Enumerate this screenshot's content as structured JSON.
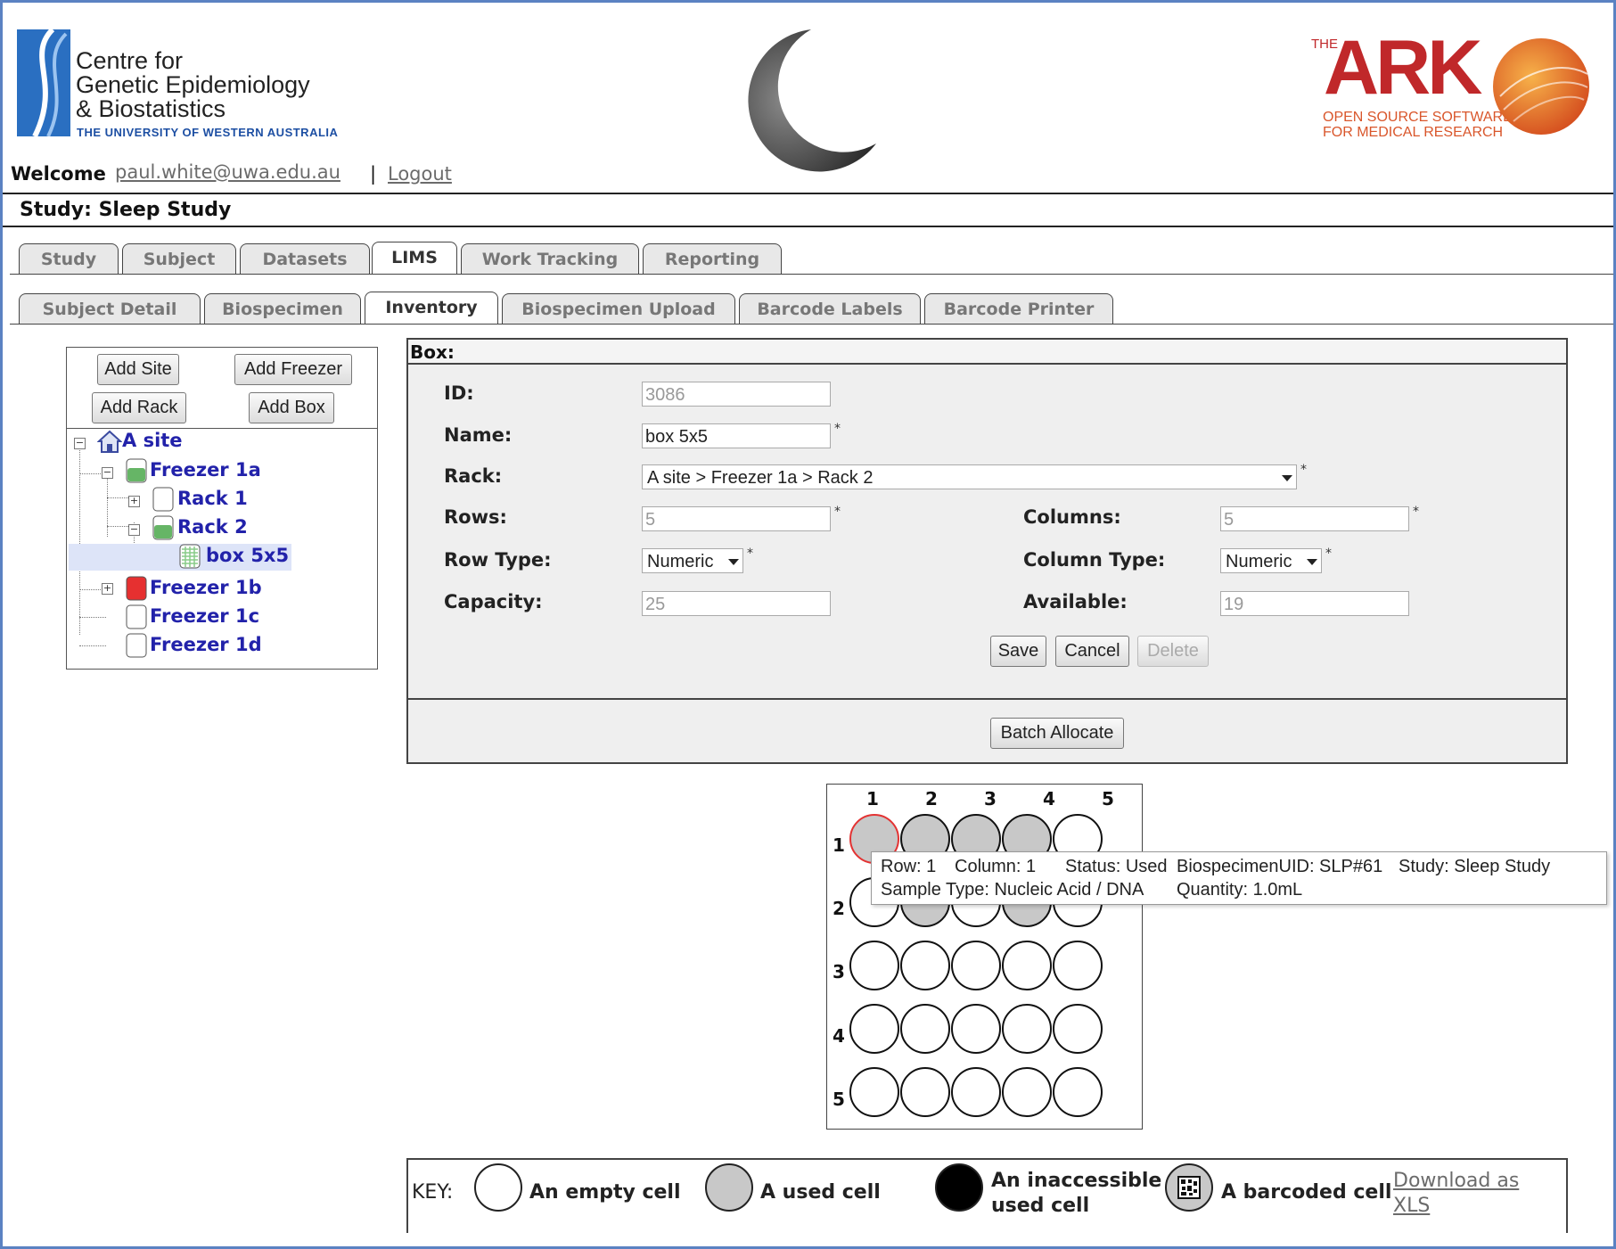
{
  "header": {
    "org_lines": [
      "Centre for",
      "Genetic Epidemiology",
      "& Biostatistics"
    ],
    "university": "THE UNIVERSITY OF WESTERN AUSTRALIA",
    "ark_the": "THE",
    "ark_title": "ARK",
    "ark_sub_lines": [
      "OPEN SOURCE SOFTWARE",
      "FOR MEDICAL RESEARCH"
    ],
    "welcome_label": "Welcome",
    "user_email": "paul.white@uwa.edu.au",
    "separator": "|",
    "logout_label": "Logout",
    "study_title": "Study: Sleep Study"
  },
  "main_tabs": [
    {
      "label": "Study",
      "active": false
    },
    {
      "label": "Subject",
      "active": false
    },
    {
      "label": "Datasets",
      "active": false
    },
    {
      "label": "LIMS",
      "active": true
    },
    {
      "label": "Work Tracking",
      "active": false
    },
    {
      "label": "Reporting",
      "active": false
    }
  ],
  "sub_tabs": [
    {
      "label": "Subject Detail",
      "active": false
    },
    {
      "label": "Biospecimen",
      "active": false
    },
    {
      "label": "Inventory",
      "active": true
    },
    {
      "label": "Biospecimen Upload",
      "active": false
    },
    {
      "label": "Barcode Labels",
      "active": false
    },
    {
      "label": "Barcode Printer",
      "active": false
    }
  ],
  "tree_buttons": {
    "add_site": "Add Site",
    "add_freezer": "Add Freezer",
    "add_rack": "Add Rack",
    "add_box": "Add Box"
  },
  "tree": [
    {
      "label": "A site",
      "icon": "house-icon"
    },
    {
      "label": "Freezer 1a",
      "icon": "freezer-icon"
    },
    {
      "label": "Rack 1",
      "icon": "rack-icon"
    },
    {
      "label": "Rack 2",
      "icon": "rack-icon"
    },
    {
      "label": "box 5x5",
      "icon": "box-icon"
    },
    {
      "label": "Freezer 1b",
      "icon": "freezer-icon"
    },
    {
      "label": "Freezer 1c",
      "icon": "freezer-icon"
    },
    {
      "label": "Freezer 1d",
      "icon": "freezer-icon"
    }
  ],
  "box_form": {
    "title": "Box:",
    "id_label": "ID:",
    "id_value": "3086",
    "name_label": "Name:",
    "name_value": "box 5x5",
    "rack_label": "Rack:",
    "rack_value": "A site > Freezer 1a   > Rack 2",
    "rows_label": "Rows:",
    "rows_value": "5",
    "columns_label": "Columns:",
    "columns_value": "5",
    "row_type_label": "Row Type:",
    "row_type_value": "Numeric",
    "column_type_label": "Column Type:",
    "column_type_value": "Numeric",
    "capacity_label": "Capacity:",
    "capacity_value": "25",
    "available_label": "Available:",
    "available_value": "19",
    "required_mark": "*",
    "save_label": "Save",
    "cancel_label": "Cancel",
    "delete_label": "Delete",
    "batch_allocate_label": "Batch Allocate"
  },
  "grid": {
    "columns": [
      "1",
      "2",
      "3",
      "4",
      "5"
    ],
    "rows": [
      "1",
      "2",
      "3",
      "4",
      "5"
    ],
    "cells": [
      [
        "used",
        "used",
        "used",
        "used",
        "empty"
      ],
      [
        "empty",
        "used",
        "empty",
        "used",
        "empty"
      ],
      [
        "empty",
        "empty",
        "empty",
        "empty",
        "empty"
      ],
      [
        "empty",
        "empty",
        "empty",
        "empty",
        "empty"
      ],
      [
        "empty",
        "empty",
        "empty",
        "empty",
        "empty"
      ]
    ],
    "highlight_color": "#e33333"
  },
  "tooltip": {
    "row": "Row: 1",
    "column": "Column: 1",
    "status": "Status: Used",
    "uid": "BiospecimenUID: SLP#61",
    "study": "Study: Sleep Study",
    "sample_type": "Sample Type: Nucleic Acid / DNA",
    "quantity": "Quantity: 1.0mL"
  },
  "key": {
    "title": "KEY:",
    "empty": "An empty cell",
    "used": "A used cell",
    "inaccessible_line1": "An inaccessible",
    "inaccessible_line2": "used cell",
    "barcoded": "A barcoded cell",
    "download_line1": "Download as",
    "download_line2": "XLS"
  },
  "colors": {
    "frame": "#5b82c2",
    "tree_link": "#2222aa",
    "used_cell": "#c8c8c8",
    "ark_red": "#c0282a"
  }
}
